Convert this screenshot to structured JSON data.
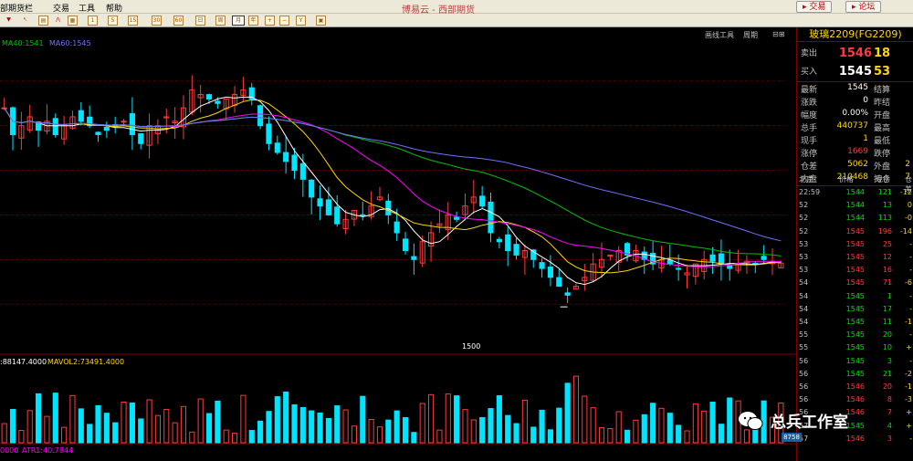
{
  "menu": {
    "items": [
      "部期货栏",
      "交易",
      "工具",
      "帮助"
    ],
    "window_title": "博易云 - 西部期货",
    "trade_btn": "交易",
    "forum_btn": "论坛"
  },
  "toolbar": {
    "period_buttons": [
      "1",
      "5",
      "15",
      "30",
      "60",
      "日",
      "周",
      "月",
      "年"
    ],
    "selected": "日"
  },
  "chart": {
    "ma_legend": [
      "MA40:1541",
      "MA60:1545"
    ],
    "vol_legend": [
      ":88147.4000",
      "MAVOL2:73491.4000"
    ],
    "atr_legend": [
      "0000",
      "ATR1:40.7844"
    ],
    "low_label": "1500",
    "top_right_tools": [
      "画线工具",
      "周期"
    ],
    "colors": {
      "up": "#ff3b3b",
      "down": "#00e5ff",
      "ma5": "#ffffff",
      "ma10": "#ffd700",
      "ma20": "#ff00ff",
      "ma40": "#00c000",
      "ma60": "#7070ff",
      "grid": "#800000"
    }
  },
  "chart_data": {
    "type": "candlestick",
    "ylim": [
      1450,
      1800
    ],
    "low_annotation": 1500,
    "closes": [
      1720,
      1690,
      1700,
      1710,
      1695,
      1705,
      1690,
      1700,
      1710,
      1705,
      1700,
      1690,
      1695,
      1700,
      1705,
      1690,
      1680,
      1700,
      1700,
      1710,
      1705,
      1720,
      1740,
      1735,
      1730,
      1725,
      1730,
      1735,
      1740,
      1730,
      1700,
      1680,
      1670,
      1660,
      1650,
      1640,
      1620,
      1610,
      1600,
      1590,
      1595,
      1605,
      1600,
      1610,
      1620,
      1600,
      1580,
      1560,
      1550,
      1570,
      1580,
      1590,
      1600,
      1595,
      1610,
      1620,
      1610,
      1580,
      1570,
      1560,
      1555,
      1560,
      1550,
      1540,
      1530,
      1520,
      1510,
      1520,
      1530,
      1545,
      1550,
      1555,
      1560,
      1555,
      1560,
      1550,
      1545,
      1550,
      1545,
      1540,
      1535,
      1545,
      1550,
      1548,
      1545,
      1540,
      1545,
      1548,
      1545,
      1550,
      1548,
      1546
    ],
    "ma40_last": 1541,
    "ma60_last": 1545,
    "volume_last": 88147.4,
    "mavol2_last": 73491.4,
    "atr_last": 40.7844
  },
  "quote": {
    "symbol": "玻璃2209(FG2209)",
    "ask_label": "卖出",
    "ask_price": "1546",
    "ask_vol": "18",
    "bid_label": "买入",
    "bid_price": "1545",
    "bid_vol": "53",
    "stats": [
      {
        "l": "最新",
        "v": "1545",
        "r": "结算"
      },
      {
        "l": "涨跌",
        "v": "0",
        "r": "昨结"
      },
      {
        "l": "幅度",
        "v": "0.00%",
        "r": "开盘"
      },
      {
        "l": "总手",
        "v": "440737",
        "r": "最高"
      },
      {
        "l": "现手",
        "v": "1",
        "r": "最低"
      },
      {
        "l": "涨停",
        "v": "1669",
        "r": "跌停"
      },
      {
        "l": "仓差",
        "v": "5062",
        "r": "外盘",
        "x": "2"
      },
      {
        "l": "内盘",
        "v": "210468",
        "r": "持仓",
        "x": "7"
      }
    ],
    "tick_header": [
      "北京",
      "价格",
      "现手",
      "仓差"
    ],
    "ticks": [
      {
        "t": "22:59",
        "p": "1544",
        "q": "121",
        "d": "-12",
        "c": "down"
      },
      {
        "t": "52",
        "p": "1544",
        "q": "13",
        "d": "0",
        "c": "down"
      },
      {
        "t": "52",
        "p": "1544",
        "q": "113",
        "d": "-0",
        "c": "down"
      },
      {
        "t": "52",
        "p": "1545",
        "q": "196",
        "d": "-14",
        "c": "up"
      },
      {
        "t": "53",
        "p": "1545",
        "q": "25",
        "d": "-",
        "c": "up"
      },
      {
        "t": "53",
        "p": "1545",
        "q": "12",
        "d": "-",
        "c": "up"
      },
      {
        "t": "53",
        "p": "1545",
        "q": "16",
        "d": "-",
        "c": "up"
      },
      {
        "t": "54",
        "p": "1545",
        "q": "71",
        "d": "-6",
        "c": "up"
      },
      {
        "t": "54",
        "p": "1545",
        "q": "1",
        "d": "-",
        "c": "down"
      },
      {
        "t": "54",
        "p": "1545",
        "q": "17",
        "d": "-",
        "c": "down"
      },
      {
        "t": "54",
        "p": "1545",
        "q": "11",
        "d": "-1",
        "c": "down"
      },
      {
        "t": "55",
        "p": "1545",
        "q": "20",
        "d": "-",
        "c": "down"
      },
      {
        "t": "55",
        "p": "1545",
        "q": "10",
        "d": "+",
        "c": "down"
      },
      {
        "t": "56",
        "p": "1545",
        "q": "3",
        "d": "-",
        "c": "down"
      },
      {
        "t": "56",
        "p": "1545",
        "q": "21",
        "d": "-2",
        "c": "down"
      },
      {
        "t": "56",
        "p": "1546",
        "q": "20",
        "d": "-1",
        "c": "up"
      },
      {
        "t": "56",
        "p": "1546",
        "q": "8",
        "d": "-3",
        "c": "up"
      },
      {
        "t": "56",
        "p": "1546",
        "q": "7",
        "d": "+",
        "c": "up"
      },
      {
        "t": "57",
        "p": "1545",
        "q": "4",
        "d": "+",
        "c": "down"
      },
      {
        "t": "57",
        "p": "1546",
        "q": "3",
        "d": "-",
        "c": "up"
      }
    ]
  },
  "watermark": {
    "text": "总兵工作室"
  },
  "status": {
    "counter": "8758"
  }
}
